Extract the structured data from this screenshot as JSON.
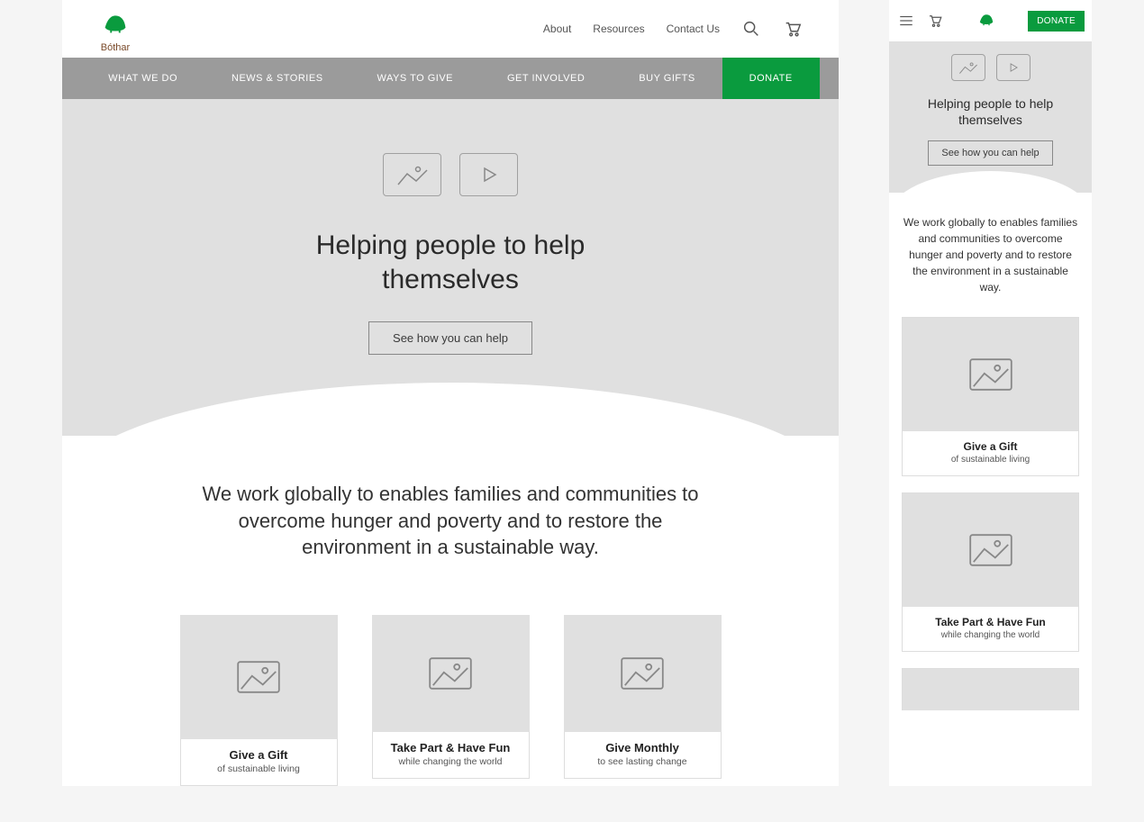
{
  "brand": {
    "name": "Bóthar"
  },
  "topnav": {
    "links": [
      "About",
      "Resources",
      "Contact Us"
    ]
  },
  "mainnav": {
    "items": [
      "WHAT WE DO",
      "NEWS & STORIES",
      "WAYS TO GIVE",
      "GET INVOLVED",
      "BUY GIFTS"
    ],
    "donate": "DONATE"
  },
  "hero": {
    "headline": "Helping people to help themselves",
    "cta": "See how you can help"
  },
  "mission": "We work globally to enables families and communities to overcome hunger and poverty and to restore the environment in a sustainable way.",
  "cards": [
    {
      "title": "Give a Gift",
      "sub": "of sustainable living"
    },
    {
      "title": "Take Part & Have Fun",
      "sub": "while changing the world"
    },
    {
      "title": "Give Monthly",
      "sub": "to see lasting change"
    }
  ],
  "mobile_cards": [
    {
      "title": "Give a Gift",
      "sub": "of sustainable living"
    },
    {
      "title": "Take Part & Have Fun",
      "sub": "while changing the world"
    }
  ]
}
